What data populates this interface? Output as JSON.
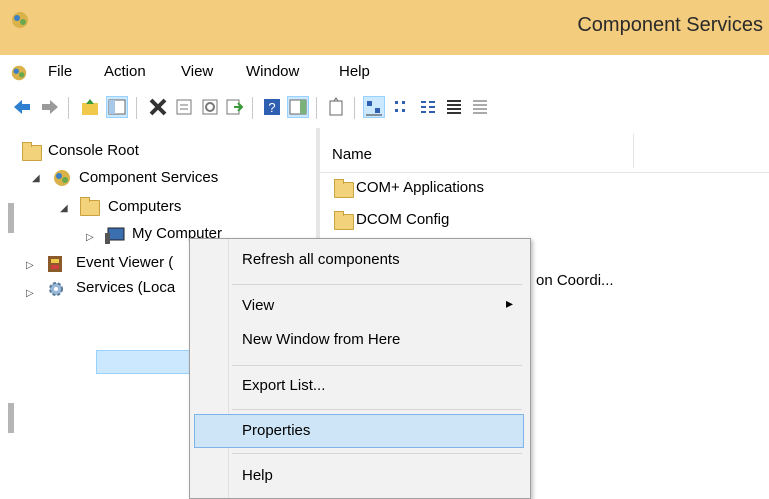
{
  "window": {
    "title": "Component Services"
  },
  "menu": [
    "File",
    "Action",
    "View",
    "Window",
    "Help"
  ],
  "toolbar": [
    "back-arrow-icon",
    "forward-arrow-icon",
    "up-folder-icon",
    "show-hide-tree-icon",
    "delete-icon",
    "properties-icon",
    "refresh-icon",
    "export-icon",
    "help-icon",
    "show-action-pane-icon",
    "new-window-icon",
    "large-icons-icon",
    "small-icons-icon",
    "list-view-icon",
    "detail-view-icon",
    "configure-icon"
  ],
  "tree": {
    "console_root": "Console Root",
    "component_services": "Component Services",
    "computers": "Computers",
    "my_computer": "My Computer",
    "event_viewer": "Event Viewer (",
    "services": "Services (Loca"
  },
  "list": {
    "column_name": "Name",
    "items": [
      "COM+ Applications",
      "DCOM Config",
      "on Coordi..."
    ]
  },
  "context_menu": {
    "refresh": "Refresh all components",
    "view": "View",
    "view_arrow": "▸",
    "new_window": "New Window from Here",
    "export": "Export List...",
    "properties": "Properties",
    "help": "Help"
  },
  "colors": {
    "titlebar": "#f3cc7e",
    "highlight": "#cde5f7",
    "selection": "#cce8ff"
  }
}
